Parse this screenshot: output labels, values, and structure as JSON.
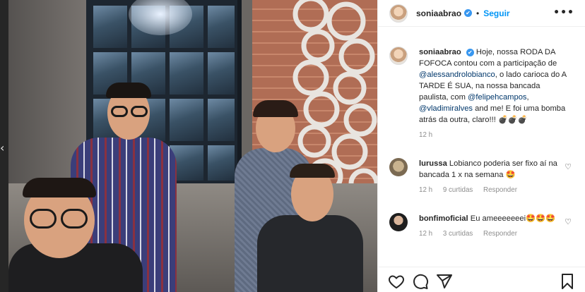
{
  "nav": {
    "prev_arrow": "‹"
  },
  "post": {
    "username": "soniaabrao",
    "verified_mark": "✔",
    "dot": "•",
    "follow_label": "Seguir",
    "more_label": "•••"
  },
  "caption": {
    "username": "soniaabrao",
    "parts": [
      {
        "text": "Hoje, nossa RODA DA FOFOCA contou com a participação de ",
        "type": "text"
      },
      {
        "text": "@alessandrolobianco",
        "type": "mention"
      },
      {
        "text": ", o lado carioca do A TARDE É SUA, na nossa bancada paulista, com ",
        "type": "text"
      },
      {
        "text": "@felipehcampos",
        "type": "mention"
      },
      {
        "text": ", ",
        "type": "text"
      },
      {
        "text": "@vladimiralves",
        "type": "mention"
      },
      {
        "text": " and me! E foi uma bomba atrás da outra, claro!!! ",
        "type": "text"
      },
      {
        "text": "💣💣💣",
        "type": "emoji"
      }
    ],
    "time": "12 h"
  },
  "comments": [
    {
      "username": "lurussa",
      "text": "Lobianco poderia ser fixo aí na bancada 1 x na semana ",
      "emoji": "🤩",
      "time": "12 h",
      "likes": "9 curtidas",
      "reply": "Responder",
      "heart": "♡"
    },
    {
      "username": "bonfimoficial",
      "text": "Eu ameeeeeeei",
      "emoji": "🤩🤩🤩",
      "time": "12 h",
      "likes": "3 curtidas",
      "reply": "Responder",
      "heart": "♡"
    }
  ],
  "actions": {
    "icons": [
      "heart-icon",
      "comment-icon",
      "share-icon",
      "bookmark-icon"
    ]
  },
  "colors": {
    "accent": "#0095f6",
    "mention": "#00376b",
    "muted": "#8e8e8e"
  }
}
